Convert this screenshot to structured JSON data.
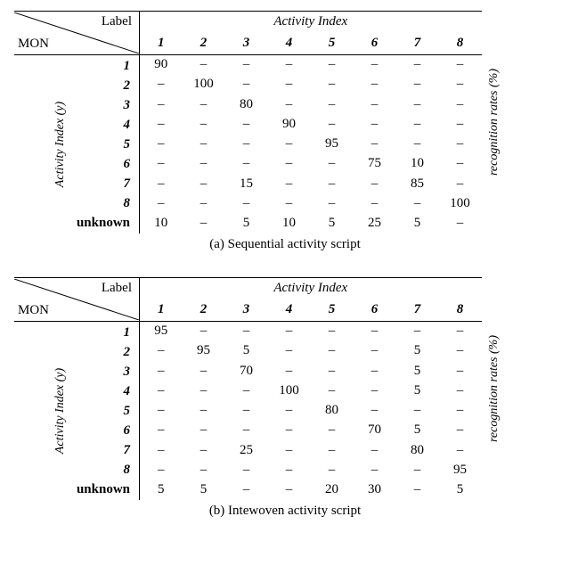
{
  "tables": [
    {
      "caption": "(a) Sequential activity script",
      "corner_top": "Label",
      "corner_bottom": "MON",
      "group_header": "Activity Index",
      "row_axis_label": "Activity Index (y)",
      "right_axis_label": "recognition rates (%)",
      "col_labels": [
        "1",
        "2",
        "3",
        "4",
        "5",
        "6",
        "7",
        "8"
      ],
      "row_labels": [
        "1",
        "2",
        "3",
        "4",
        "5",
        "6",
        "7",
        "8",
        "unknown"
      ],
      "cells": [
        [
          "90",
          "–",
          "–",
          "–",
          "–",
          "–",
          "–",
          "–"
        ],
        [
          "–",
          "100",
          "–",
          "–",
          "–",
          "–",
          "–",
          "–"
        ],
        [
          "–",
          "–",
          "80",
          "–",
          "–",
          "–",
          "–",
          "–"
        ],
        [
          "–",
          "–",
          "–",
          "90",
          "–",
          "–",
          "–",
          "–"
        ],
        [
          "–",
          "–",
          "–",
          "–",
          "95",
          "–",
          "–",
          "–"
        ],
        [
          "–",
          "–",
          "–",
          "–",
          "–",
          "75",
          "10",
          "–"
        ],
        [
          "–",
          "–",
          "15",
          "–",
          "–",
          "–",
          "85",
          "–"
        ],
        [
          "–",
          "–",
          "–",
          "–",
          "–",
          "–",
          "–",
          "100"
        ],
        [
          "10",
          "–",
          "5",
          "10",
          "5",
          "25",
          "5",
          "–"
        ]
      ]
    },
    {
      "caption": "(b) Intewoven activity script",
      "corner_top": "Label",
      "corner_bottom": "MON",
      "group_header": "Activity Index",
      "row_axis_label": "Activity Index (y)",
      "right_axis_label": "recognition rates (%)",
      "col_labels": [
        "1",
        "2",
        "3",
        "4",
        "5",
        "6",
        "7",
        "8"
      ],
      "row_labels": [
        "1",
        "2",
        "3",
        "4",
        "5",
        "6",
        "7",
        "8",
        "unknown"
      ],
      "cells": [
        [
          "95",
          "–",
          "–",
          "–",
          "–",
          "–",
          "–",
          "–"
        ],
        [
          "–",
          "95",
          "5",
          "–",
          "–",
          "–",
          "5",
          "–"
        ],
        [
          "–",
          "–",
          "70",
          "–",
          "–",
          "–",
          "5",
          "–"
        ],
        [
          "–",
          "–",
          "–",
          "100",
          "–",
          "–",
          "5",
          "–"
        ],
        [
          "–",
          "–",
          "–",
          "–",
          "80",
          "–",
          "–",
          "–"
        ],
        [
          "–",
          "–",
          "–",
          "–",
          "–",
          "70",
          "5",
          "–"
        ],
        [
          "–",
          "–",
          "25",
          "–",
          "–",
          "–",
          "80",
          "–"
        ],
        [
          "–",
          "–",
          "–",
          "–",
          "–",
          "–",
          "–",
          "95"
        ],
        [
          "5",
          "5",
          "–",
          "–",
          "20",
          "30",
          "–",
          "5"
        ]
      ]
    }
  ]
}
